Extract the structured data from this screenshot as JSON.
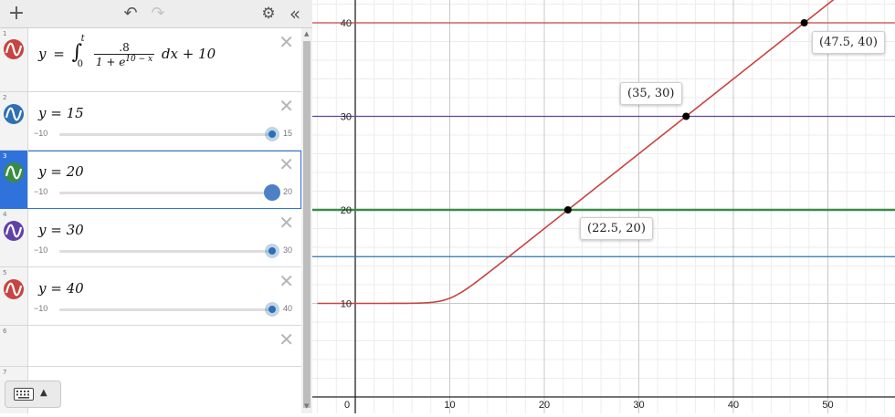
{
  "toolbar": {
    "add": "+",
    "undo": "↶",
    "redo": "↷",
    "settings": "⚙",
    "collapse": "«"
  },
  "expressions": [
    {
      "index": "1",
      "color": "#c74440",
      "parts": {
        "lhs": "y",
        "eq": "=",
        "int": "∫",
        "upper": "t",
        "lower": "0",
        "num": ".8",
        "den_a": "1 + e",
        "den_exp": "10 − x",
        "dx": "dx + 10"
      }
    },
    {
      "index": "2",
      "color": "#2d70b3",
      "text": "y = 15",
      "slider": {
        "min": "−10",
        "max": "15",
        "value_pct": 100
      }
    },
    {
      "index": "3",
      "color": "#388c46",
      "text": "y = 20",
      "slider": {
        "min": "−10",
        "max": "20",
        "value_pct": 100
      }
    },
    {
      "index": "4",
      "color": "#6042a6",
      "text": "y = 30",
      "slider": {
        "min": "−10",
        "max": "30",
        "value_pct": 100
      }
    },
    {
      "index": "5",
      "color": "#c74440",
      "text": "y = 40",
      "slider": {
        "min": "−10",
        "max": "40",
        "value_pct": 100
      }
    },
    {
      "index": "6"
    },
    {
      "index": "7"
    }
  ],
  "keyboard": {
    "icon": "keyboard-icon",
    "caret": "▲"
  },
  "graph": {
    "x_ticks": [
      "0",
      "10",
      "20",
      "30",
      "40",
      "50"
    ],
    "y_ticks": [
      "10",
      "20",
      "30",
      "40"
    ],
    "points": [
      {
        "label": "(22.5, 20)"
      },
      {
        "label": "(35, 30)"
      },
      {
        "label": "(47.5, 40)"
      }
    ]
  }
}
